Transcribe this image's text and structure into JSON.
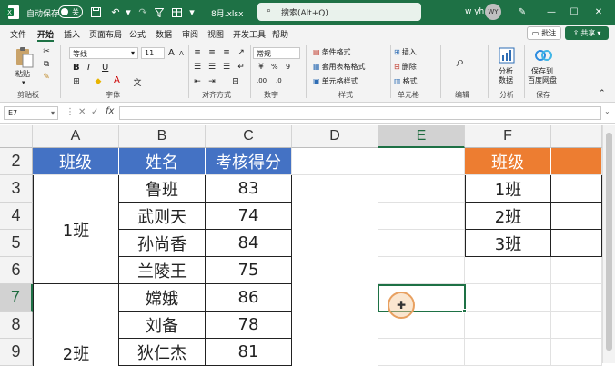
{
  "titlebar": {
    "autosave_label": "自动保存",
    "autosave_state": "关",
    "filename": "8月.xlsx",
    "search_placeholder": "搜索(Alt+Q)",
    "user": "w yh",
    "avatar_initials": "WY",
    "minimize": "—",
    "restore": "☐",
    "close": "✕"
  },
  "menu": {
    "tabs": [
      "文件",
      "开始",
      "插入",
      "页面布局",
      "公式",
      "数据",
      "审阅",
      "视图",
      "开发工具",
      "帮助"
    ],
    "active_index": 1,
    "comment_btn": "批注",
    "share_btn": "共享"
  },
  "ribbon": {
    "paste": "粘贴",
    "clipboard": "剪贴板",
    "font_name": "等线",
    "font_size": "11",
    "bold": "B",
    "italic": "I",
    "underline": "U",
    "grow": "A",
    "shrink": "A",
    "font_color_glyph": "A",
    "font_group": "字体",
    "align_group": "对齐方式",
    "number_format": "常规",
    "percent": "%",
    "comma": "9",
    "dec_inc": ".00",
    "dec_dec": ".0",
    "number_group": "数字",
    "cond_format": "条件格式",
    "table_format": "套用表格格式",
    "cell_style": "单元格样式",
    "styles_group": "样式",
    "insert": "插入",
    "delete": "删除",
    "format": "格式",
    "cells_group": "单元格",
    "editing_group": "编辑",
    "analyze": "分析",
    "analyze_data": "数据",
    "analyze_group": "分析",
    "save_to": "保存到",
    "baidu": "百度网盘",
    "save_group": "保存"
  },
  "formula_bar": {
    "name_box": "E7",
    "fx": "fx",
    "formula": ""
  },
  "sheet": {
    "columns": [
      "A",
      "B",
      "C",
      "D",
      "E",
      "F"
    ],
    "rows": [
      "2",
      "3",
      "4",
      "5",
      "6",
      "7",
      "8",
      "9"
    ],
    "selected_cell": "E7",
    "header_class": "班级",
    "header_name": "姓名",
    "header_score": "考核得分",
    "class_1": "1班",
    "class_2": "2班",
    "names": [
      "鲁班",
      "武则天",
      "孙尚香",
      "兰陵王",
      "嫦娥",
      "刘备",
      "狄仁杰"
    ],
    "scores": [
      "83",
      "74",
      "84",
      "75",
      "86",
      "78",
      "81"
    ],
    "f_header": "班级",
    "f_values": [
      "1班",
      "2班",
      "3班"
    ]
  },
  "colors": {
    "excel_green": "#1e7145",
    "header_blue": "#4472c4",
    "header_orange": "#ed7d31"
  }
}
